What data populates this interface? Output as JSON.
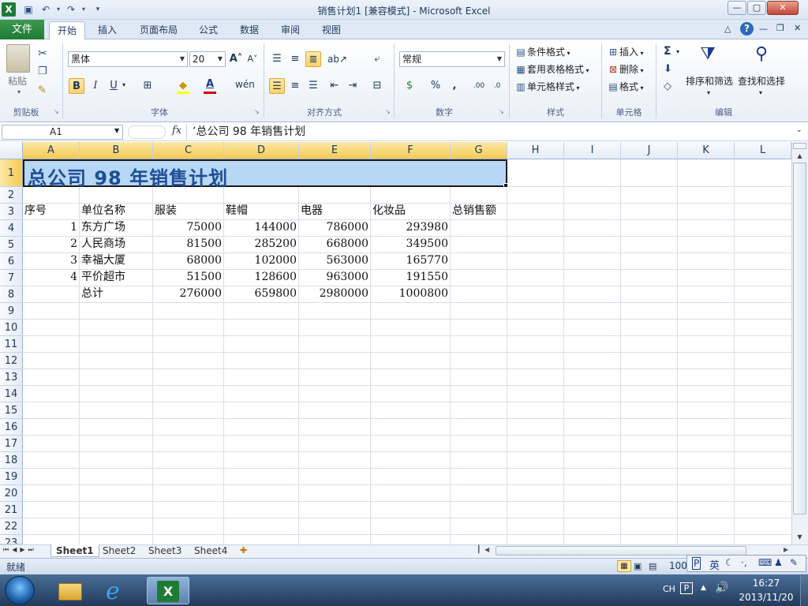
{
  "window": {
    "title": "销售计划1  [兼容模式]  -  Microsoft Excel",
    "app_icon": "X"
  },
  "tabs": {
    "file": "文件",
    "items": [
      "开始",
      "插入",
      "页面布局",
      "公式",
      "数据",
      "审阅",
      "视图"
    ],
    "active": "开始"
  },
  "ribbon": {
    "clipboard": {
      "paste": "粘贴",
      "group": "剪贴板"
    },
    "font": {
      "name": "黑体",
      "size": "20",
      "bold": "B",
      "italic": "I",
      "underline": "U",
      "group": "字体",
      "wen": "wén"
    },
    "alignment": {
      "group": "对齐方式"
    },
    "number": {
      "format": "常规",
      "percent": "%",
      "comma": ",",
      "group": "数字"
    },
    "styles": {
      "conditional": "条件格式",
      "table": "套用表格格式",
      "cell": "单元格样式",
      "group": "样式"
    },
    "cells": {
      "insert": "插入",
      "delete": "删除",
      "format": "格式",
      "group": "单元格"
    },
    "editing": {
      "sort": "排序和筛选",
      "find": "查找和选择",
      "group": "编辑",
      "sum": "Σ"
    }
  },
  "formula_bar": {
    "name_box": "A1",
    "fx": "fx",
    "content": "’总公司 98 年销售计划"
  },
  "columns": [
    "A",
    "B",
    "C",
    "D",
    "E",
    "F",
    "G",
    "H",
    "I",
    "J",
    "K",
    "L"
  ],
  "selected_columns": [
    "A",
    "B",
    "C",
    "D",
    "E",
    "F",
    "G"
  ],
  "rows": [
    "1",
    "2",
    "3",
    "4",
    "5",
    "6",
    "7",
    "8",
    "9",
    "10",
    "11",
    "12",
    "13",
    "14",
    "15",
    "16",
    "17",
    "18",
    "19",
    "20",
    "21",
    "22",
    "23"
  ],
  "sheet": {
    "title": "总公司 98 年销售计划",
    "headers": [
      "序号",
      "单位名称",
      "服装",
      "鞋帽",
      "电器",
      "化妆品",
      "总销售额"
    ],
    "data": [
      [
        "1",
        "东方广场",
        "75000",
        "144000",
        "786000",
        "293980"
      ],
      [
        "2",
        "人民商场",
        "81500",
        "285200",
        "668000",
        "349500"
      ],
      [
        "3",
        "幸福大厦",
        "68000",
        "102000",
        "563000",
        "165770"
      ],
      [
        "4",
        "平价超市",
        "51500",
        "128600",
        "963000",
        "191550"
      ]
    ],
    "total": [
      "总计",
      "276000",
      "659800",
      "2980000",
      "1000800"
    ]
  },
  "sheet_tabs": [
    "Sheet1",
    "Sheet2",
    "Sheet3",
    "Sheet4"
  ],
  "active_sheet": "Sheet1",
  "status": {
    "ready": "就绪",
    "zoom": "100"
  },
  "ime": {
    "lang": "英"
  },
  "taskbar": {
    "lang": "CH",
    "time": "16:27",
    "date": "2013/11/20"
  },
  "colors": {
    "excel_green": "#1f7a35",
    "header_highlight": "#f5c954",
    "title_fill": "#b8d7f5",
    "title_text": "#1f4e96"
  }
}
